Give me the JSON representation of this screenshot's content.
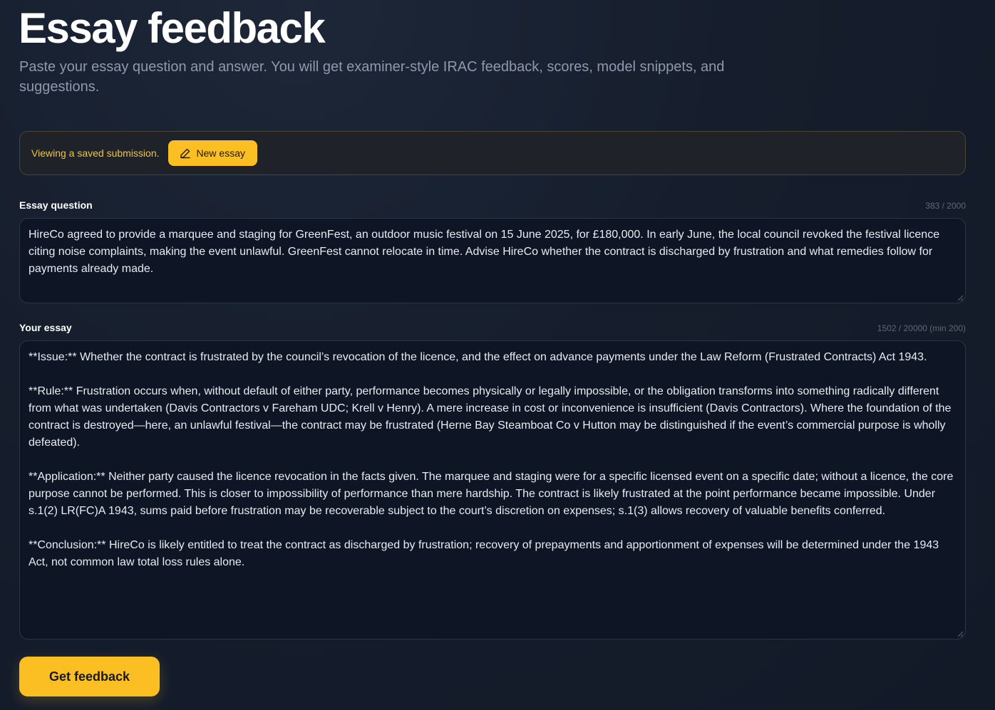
{
  "header": {
    "title": "Essay feedback",
    "subtitle": "Paste your essay question and answer. You will get examiner-style IRAC feedback, scores, model snippets, and suggestions."
  },
  "banner": {
    "text": "Viewing a saved submission.",
    "new_essay_label": "New essay",
    "icon": "pencil-icon"
  },
  "question": {
    "label": "Essay question",
    "counter": "383 / 2000",
    "value": "HireCo agreed to provide a marquee and staging for GreenFest, an outdoor music festival on 15 June 2025, for £180,000. In early June, the local council revoked the festival licence citing noise complaints, making the event unlawful. GreenFest cannot relocate in time. Advise HireCo whether the contract is discharged by frustration and what remedies follow for payments already made."
  },
  "essay": {
    "label": "Your essay",
    "counter": "1502 / 20000 (min 200)",
    "value": "**Issue:** Whether the contract is frustrated by the council’s revocation of the licence, and the effect on advance payments under the Law Reform (Frustrated Contracts) Act 1943.\n\n**Rule:** Frustration occurs when, without default of either party, performance becomes physically or legally impossible, or the obligation transforms into something radically different from what was undertaken (Davis Contractors v Fareham UDC; Krell v Henry). A mere increase in cost or inconvenience is insufficient (Davis Contractors). Where the foundation of the contract is destroyed—here, an unlawful festival—the contract may be frustrated (Herne Bay Steamboat Co v Hutton may be distinguished if the event’s commercial purpose is wholly defeated).\n\n**Application:** Neither party caused the licence revocation in the facts given. The marquee and staging were for a specific licensed event on a specific date; without a licence, the core purpose cannot be performed. This is closer to impossibility of performance than mere hardship. The contract is likely frustrated at the point performance became impossible. Under s.1(2) LR(FC)A 1943, sums paid before frustration may be recoverable subject to the court’s discretion on expenses; s.1(3) allows recovery of valuable benefits conferred.\n\n**Conclusion:** HireCo is likely entitled to treat the contract as discharged by frustration; recovery of prepayments and apportionment of expenses will be determined under the 1943 Act, not common law total loss rules alone."
  },
  "actions": {
    "submit_label": "Get feedback"
  },
  "colors": {
    "accent": "#fbbf24",
    "background": "#161e2d",
    "banner_text": "#f0c73a"
  }
}
